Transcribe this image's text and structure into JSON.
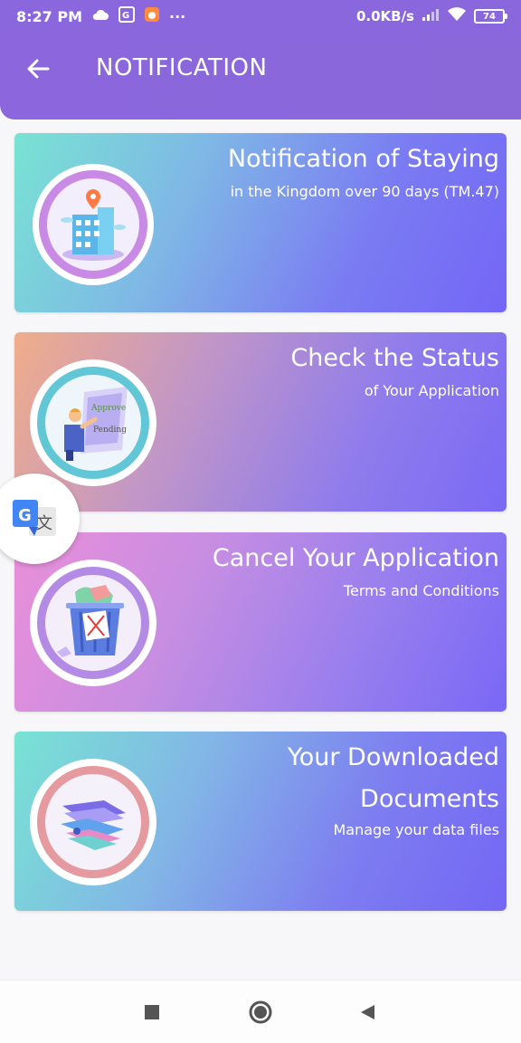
{
  "status_bar": {
    "time": "8:27 PM",
    "more": "···",
    "network_speed": "0.0KB/s",
    "battery": "74"
  },
  "appbar": {
    "title": "NOTIFICATION",
    "back_icon": "arrow-left-icon"
  },
  "cards": [
    {
      "title": "Notification of Staying",
      "subtitle": "in the Kingdom over 90 days (TM.47)",
      "icon": "building-location-icon"
    },
    {
      "title": "Check the Status",
      "subtitle": "of Your Application",
      "icon": "document-status-icon"
    },
    {
      "title": "Cancel Your Application",
      "subtitle": "Terms and Conditions",
      "icon": "trash-bin-icon"
    },
    {
      "title_line1": "Your Downloaded",
      "title_line2": "Documents",
      "subtitle": "Manage your data files",
      "icon": "document-stack-icon"
    }
  ],
  "colors": {
    "appbar": "#8a67dc",
    "accent": "#7466f6"
  }
}
